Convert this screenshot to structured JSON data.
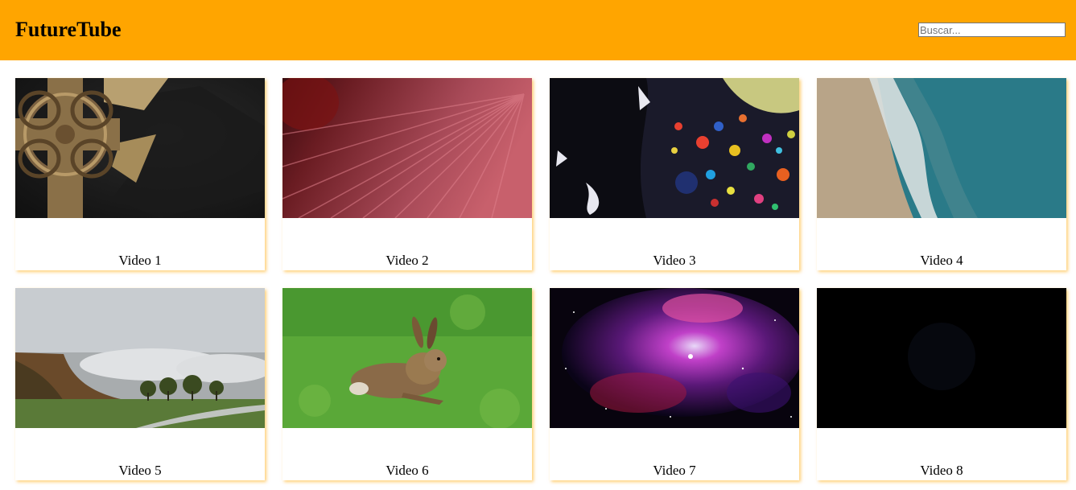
{
  "header": {
    "title": "FutureTube",
    "background_color": "#ffa500",
    "search_placeholder": "Buscar..."
  },
  "videos": [
    {
      "title": "Video 1",
      "thumbnail": "celtic-cross"
    },
    {
      "title": "Video 2",
      "thumbnail": "pink-light-rays"
    },
    {
      "title": "Video 3",
      "thumbnail": "colorful-ink-bubbles"
    },
    {
      "title": "Video 4",
      "thumbnail": "aerial-beach-waves"
    },
    {
      "title": "Video 5",
      "thumbnail": "misty-countryside"
    },
    {
      "title": "Video 6",
      "thumbnail": "hare-on-grass"
    },
    {
      "title": "Video 7",
      "thumbnail": "purple-nebula"
    },
    {
      "title": "Video 8",
      "thumbnail": "dark-nasa-logo"
    }
  ]
}
